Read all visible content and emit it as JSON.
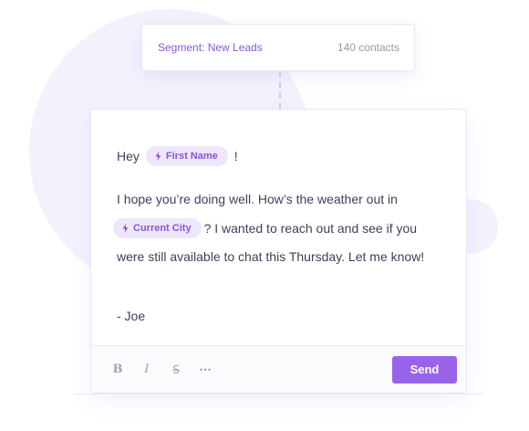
{
  "segment": {
    "label": "Segment: New Leads",
    "count": "140 contacts"
  },
  "email": {
    "greeting": "Hey",
    "greeting_punct": "!",
    "first_name_token": "First Name",
    "line1": "I hope you’re doing well. How’s the weather out in",
    "current_city_token": "Current City",
    "line2_rest": "? I wanted to reach out and see if you",
    "line3": "were still available to chat this Thursday. Let me know!",
    "signature": "- Joe"
  },
  "toolbar": {
    "bold": "B",
    "italic": "I",
    "strike": "S",
    "more": "···",
    "send_label": "Send"
  },
  "colors": {
    "accent": "#9a62ea",
    "token_bg": "#eee7fc",
    "token_text": "#8a56d8",
    "blob": "#f4f1fd"
  },
  "icons": {
    "token_icon": "lightning-bolt-icon"
  }
}
